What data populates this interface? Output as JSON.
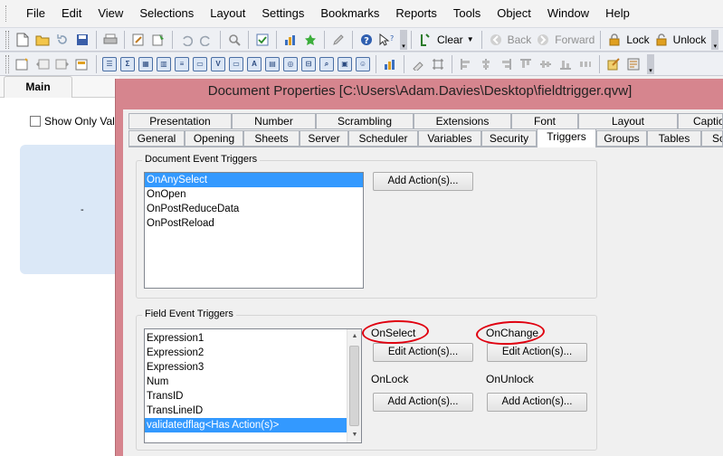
{
  "menubar": {
    "items": [
      "File",
      "Edit",
      "View",
      "Selections",
      "Layout",
      "Settings",
      "Bookmarks",
      "Reports",
      "Tools",
      "Object",
      "Window",
      "Help"
    ]
  },
  "toolbar": {
    "clear_label": "Clear",
    "back_label": "Back",
    "forward_label": "Forward",
    "lock_label": "Lock",
    "unlock_label": "Unlock"
  },
  "sheet": {
    "tab_label": "Main",
    "checkbox_label": "Show Only Valid",
    "panel_text": "-"
  },
  "dialog": {
    "title": "Document Properties [C:\\Users\\Adam.Davies\\Desktop\\fieldtrigger.qvw]",
    "tabs_row1": [
      "Presentation",
      "Number",
      "Scrambling",
      "Extensions",
      "Font",
      "Layout",
      "Caption"
    ],
    "tabs_row2": [
      "General",
      "Opening",
      "Sheets",
      "Server",
      "Scheduler",
      "Variables",
      "Security",
      "Triggers",
      "Groups",
      "Tables",
      "Sort"
    ],
    "active_tab": "Triggers",
    "document_triggers": {
      "title": "Document Event Triggers",
      "items": [
        "OnAnySelect",
        "OnOpen",
        "OnPostReduceData",
        "OnPostReload"
      ],
      "selected_index": 0,
      "add_button": "Add Action(s)..."
    },
    "field_triggers": {
      "title": "Field Event Triggers",
      "items": [
        "Expression1",
        "Expression2",
        "Expression3",
        "Num",
        "TransID",
        "TransLineID",
        "validatedflag<Has Action(s)>"
      ],
      "selected_index": 6,
      "on_select_label": "OnSelect",
      "on_change_label": "OnChange",
      "on_lock_label": "OnLock",
      "on_unlock_label": "OnUnlock",
      "edit_select_button": "Edit Action(s)...",
      "edit_change_button": "Edit Action(s)...",
      "add_lock_button": "Add Action(s)...",
      "add_unlock_button": "Add Action(s)..."
    }
  },
  "colors": {
    "dialog_frame": "#d6858e",
    "selection": "#3399ff",
    "annotation": "#e00010",
    "sheet_panel": "#dbe8f7"
  }
}
